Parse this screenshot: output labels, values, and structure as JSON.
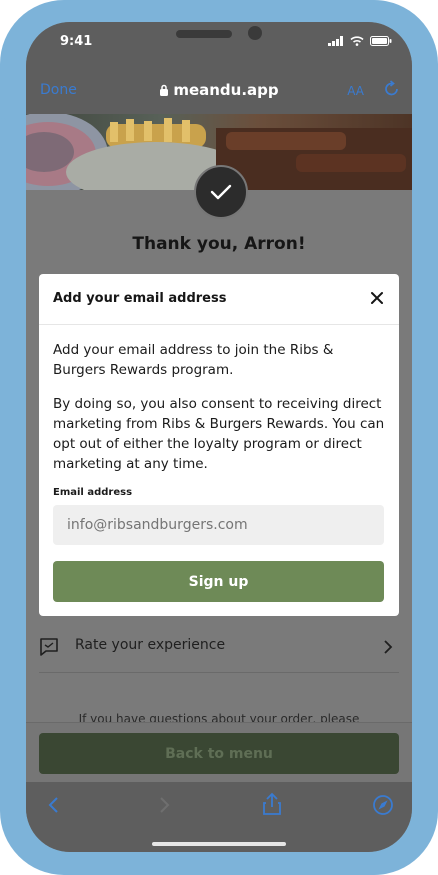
{
  "status_bar": {
    "time": "9:41"
  },
  "browser": {
    "done_label": "Done",
    "url": "meandu.app",
    "text_size_label": "AA"
  },
  "page": {
    "thanks": "Thank you, Arron!",
    "rate_label": "Rate your experience",
    "questions_text": "If you have questions about your order, please",
    "back_label": "Back to menu"
  },
  "modal": {
    "title": "Add your email address",
    "paragraph1": "Add your email address to join the Ribs & Burgers Rewards program.",
    "paragraph2": "By doing so, you also consent to receiving direct marketing from Ribs & Burgers Rewards. You can opt out of either the loyalty program or direct marketing at any time.",
    "email_label": "Email address",
    "email_placeholder": "info@ribsandburgers.com",
    "signup_label": "Sign up"
  },
  "colors": {
    "accent": "#3a7bd0",
    "button_green": "#6e8a57",
    "frame": "#7db3d9"
  }
}
